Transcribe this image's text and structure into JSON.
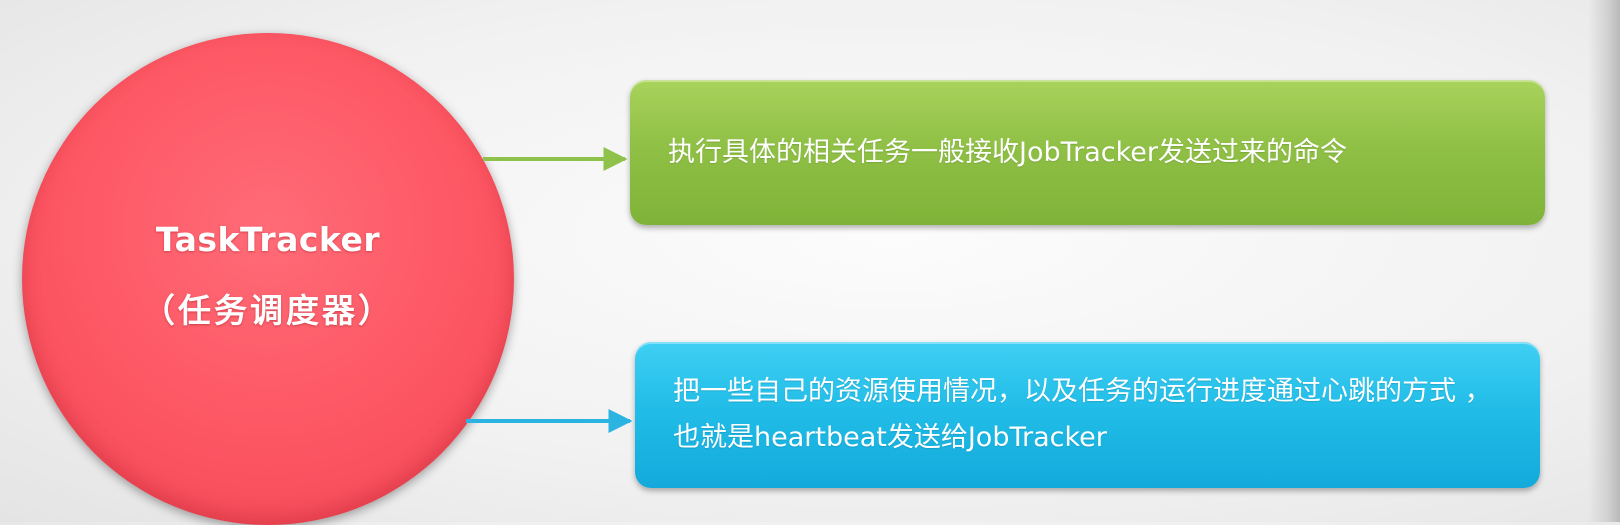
{
  "node": {
    "title": "TaskTracker",
    "subtitle": "（任务调度器）"
  },
  "functions": [
    {
      "text": "执行具体的相关任务一般接收JobTracker发送过来的命令"
    },
    {
      "text": "把一些自己的资源使用情况，以及任务的运行进度通过心跳的方式 ，也就是heartbeat发送给JobTracker"
    }
  ],
  "colors": {
    "node": "#fd5663",
    "box_1": "#90c046",
    "box_2": "#21bde8",
    "connector_1": "#8fc24a",
    "connector_2": "#2bb3e2"
  }
}
